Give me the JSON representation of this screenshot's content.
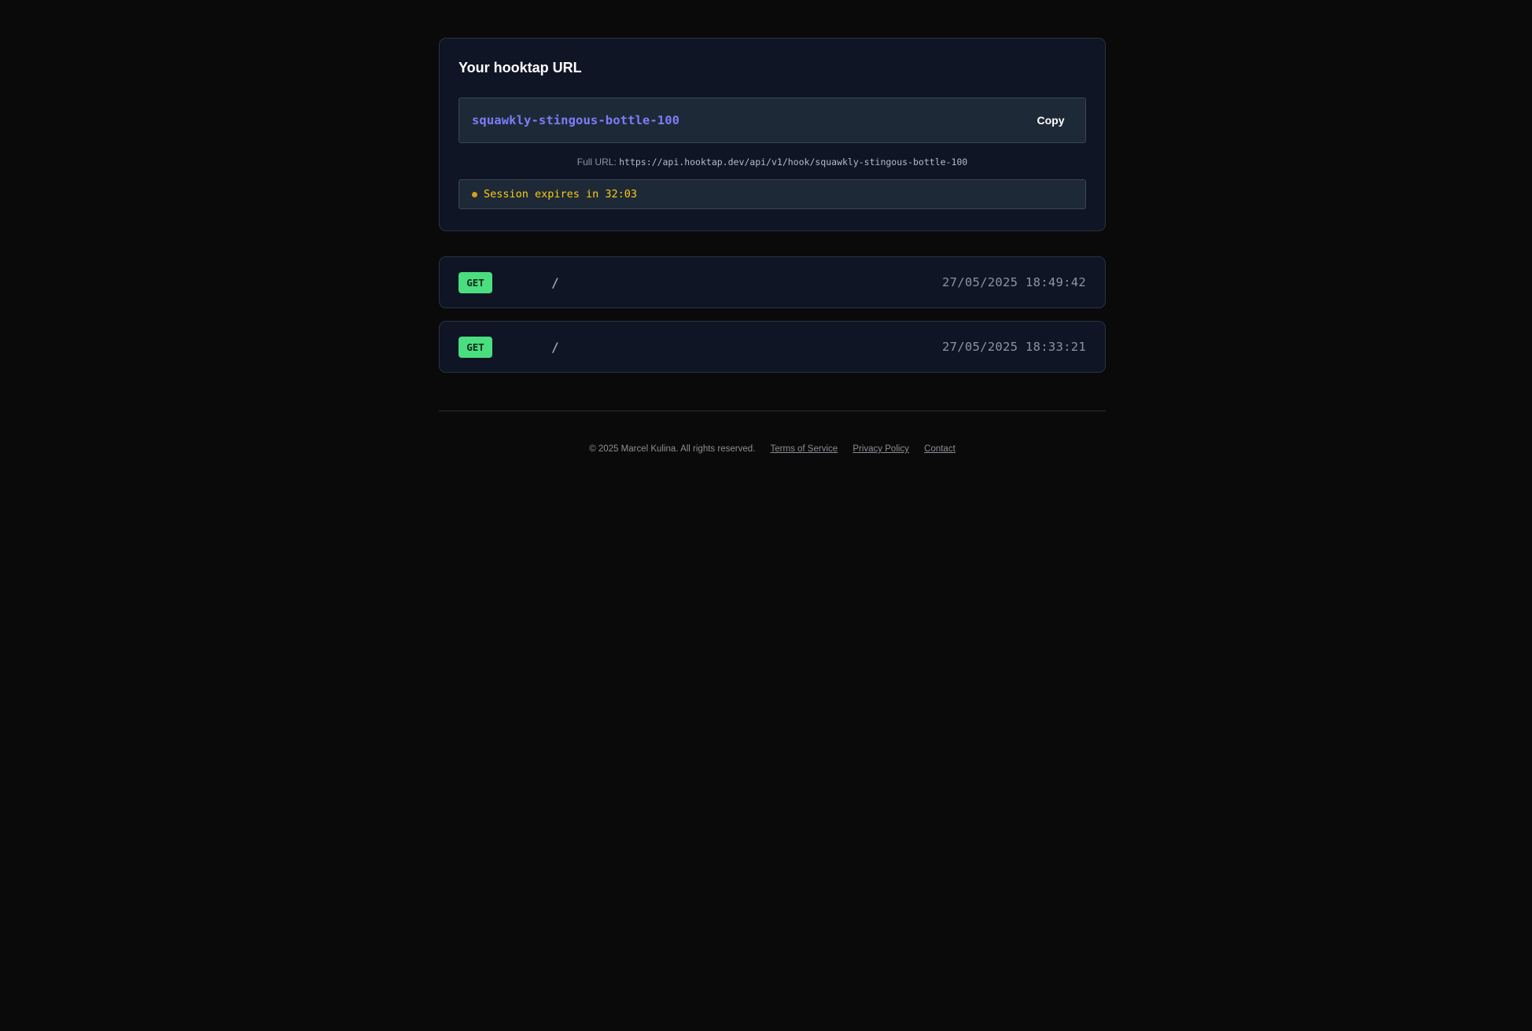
{
  "url_card": {
    "title": "Your hooktap URL",
    "slug": "squawkly-stingous-bottle-100",
    "copy_label": "Copy",
    "full_url_label": "Full URL:",
    "full_url": "https://api.hooktap.dev/api/v1/hook/squawkly-stingous-bottle-100",
    "session_text": "Session expires in 32:03"
  },
  "requests": [
    {
      "method": "GET",
      "path": "/",
      "timestamp": "27/05/2025 18:49:42"
    },
    {
      "method": "GET",
      "path": "/",
      "timestamp": "27/05/2025 18:33:21"
    }
  ],
  "footer": {
    "copyright": "© 2025 Marcel Kulina. All rights reserved.",
    "links": [
      "Terms of Service",
      "Privacy Policy",
      "Contact"
    ]
  },
  "colors": {
    "background": "#0a0a0a",
    "card": "#0f1524",
    "accent": "#7c7df8",
    "method_get": "#4ade80",
    "session_warning": "#facc15"
  },
  "icons": {
    "session_status": "status-dot-icon"
  }
}
